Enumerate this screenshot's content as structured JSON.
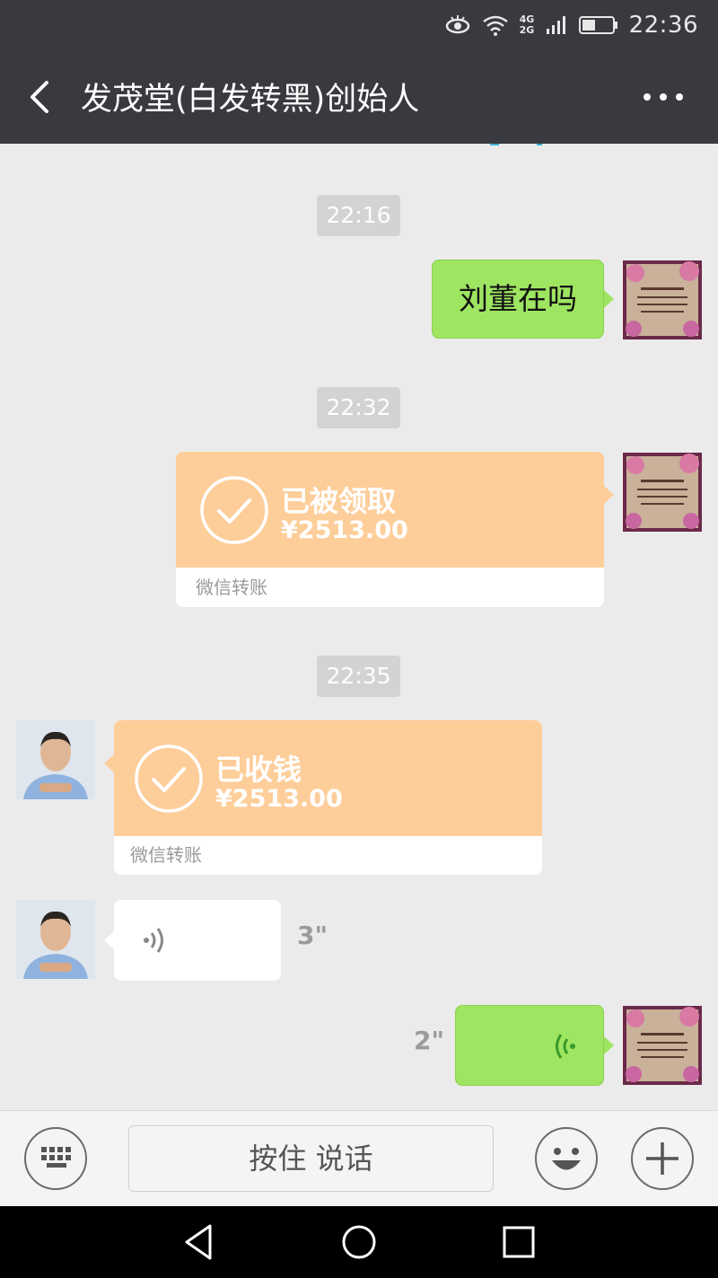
{
  "status_bar": {
    "time": "22:36",
    "network": "4G 2G"
  },
  "header": {
    "title": "发茂堂(白发转黑)创始人"
  },
  "messages": {
    "ts1": "22:16",
    "text1": "刘董在吗",
    "ts2": "22:32",
    "transfer1": {
      "title": "已被领取",
      "amount": "¥2513.00",
      "footer": "微信转账"
    },
    "ts3": "22:35",
    "transfer2": {
      "title": "已收钱",
      "amount": "¥2513.00",
      "footer": "微信转账"
    },
    "voice_in_duration": "3\"",
    "voice_out_duration": "2\""
  },
  "input_bar": {
    "hold_to_talk": "按住 说话"
  },
  "colors": {
    "sent_bubble": "#9ee561",
    "transfer_card": "#fdce9a",
    "header_bg": "#393a3f",
    "chat_bg": "#ebebeb"
  }
}
